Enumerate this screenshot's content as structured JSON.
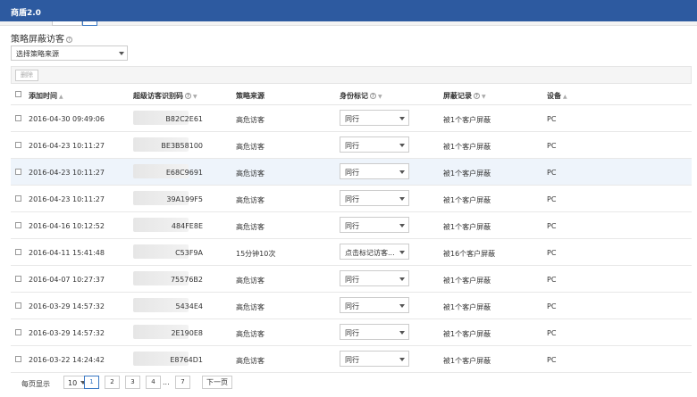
{
  "app": {
    "title": "商盾2.0"
  },
  "section": {
    "title": "策略屏蔽访客"
  },
  "source_filter": {
    "value": "选择策略来源"
  },
  "toolbar": {
    "delete_label": "删除"
  },
  "table": {
    "headers": {
      "time": "添加时间",
      "visitor_id": "超级访客识别码",
      "source": "策略来源",
      "tag": "身份标记",
      "record": "屏蔽记录",
      "device": "设备"
    },
    "rows": [
      {
        "time": "2016-04-30 09:49:06",
        "id_suffix": "B82C2E61",
        "source": "高危访客",
        "tag": "同行",
        "record": "被1个客户屏蔽",
        "device": "PC"
      },
      {
        "time": "2016-04-23 10:11:27",
        "id_suffix": "BE3B58100",
        "source": "高危访客",
        "tag": "同行",
        "record": "被1个客户屏蔽",
        "device": "PC"
      },
      {
        "time": "2016-04-23 10:11:27",
        "id_suffix": "E68C9691",
        "source": "高危访客",
        "tag": "同行",
        "record": "被1个客户屏蔽",
        "device": "PC"
      },
      {
        "time": "2016-04-23 10:11:27",
        "id_suffix": "39A199F5",
        "source": "高危访客",
        "tag": "同行",
        "record": "被1个客户屏蔽",
        "device": "PC"
      },
      {
        "time": "2016-04-16 10:12:52",
        "id_suffix": "484FE8E",
        "source": "高危访客",
        "tag": "同行",
        "record": "被1个客户屏蔽",
        "device": "PC"
      },
      {
        "time": "2016-04-11 15:41:48",
        "id_suffix": "C53F9A",
        "source": "15分钟10次",
        "tag": "点击标记访客...",
        "record": "被16个客户屏蔽",
        "device": "PC"
      },
      {
        "time": "2016-04-07 10:27:37",
        "id_suffix": "75576B2",
        "source": "高危访客",
        "tag": "同行",
        "record": "被1个客户屏蔽",
        "device": "PC"
      },
      {
        "time": "2016-03-29 14:57:32",
        "id_suffix": "5434E4",
        "source": "高危访客",
        "tag": "同行",
        "record": "被1个客户屏蔽",
        "device": "PC"
      },
      {
        "time": "2016-03-29 14:57:32",
        "id_suffix": "2E190E8",
        "source": "高危访客",
        "tag": "同行",
        "record": "被1个客户屏蔽",
        "device": "PC"
      },
      {
        "time": "2016-03-22 14:24:42",
        "id_suffix": "E8764D1",
        "source": "高危访客",
        "tag": "同行",
        "record": "被1个客户屏蔽",
        "device": "PC"
      }
    ]
  },
  "pager": {
    "per_page_label": "每页显示",
    "per_page_value": "10",
    "pages": [
      "1",
      "2",
      "3",
      "4",
      "7"
    ],
    "ellipsis": "...",
    "next_label": "下一页"
  }
}
